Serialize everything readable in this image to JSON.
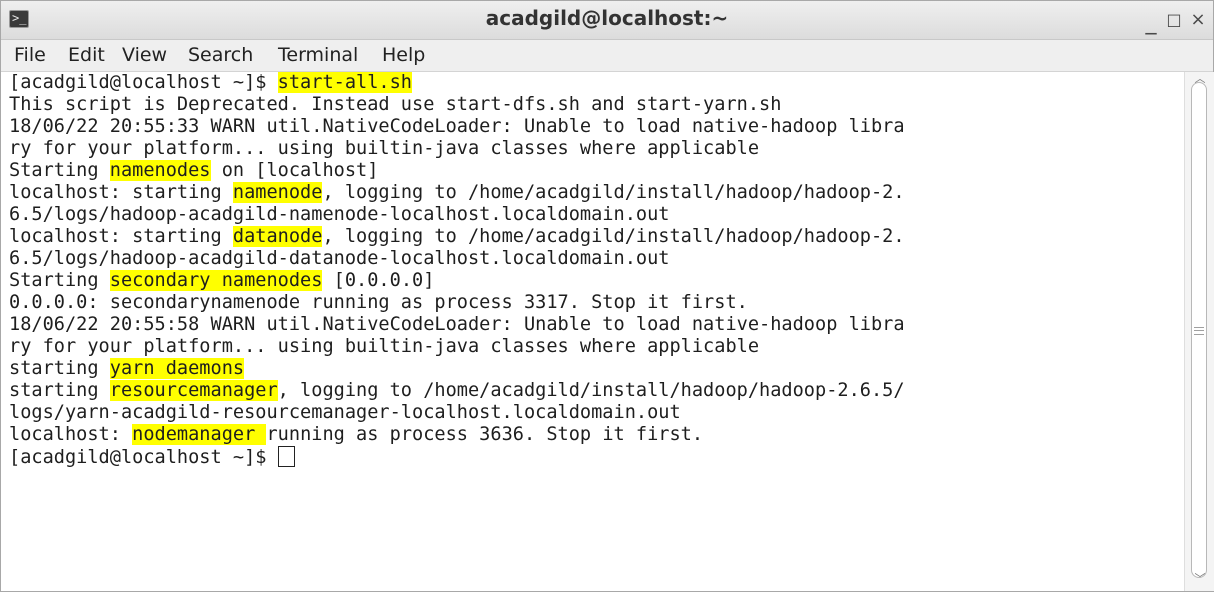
{
  "window": {
    "title": "acadgild@localhost:~",
    "icon": "terminal-icon",
    "controls": {
      "minimize": "_",
      "maximize": "□",
      "close": "×"
    }
  },
  "menu": [
    "File",
    "Edit",
    "View",
    "Search",
    "Terminal",
    "Help"
  ],
  "terminal": {
    "highlight_color": "#ffff00",
    "lines": [
      [
        {
          "t": "[acadgild@localhost ~]$ "
        },
        {
          "t": "start-all.sh",
          "hl": true
        }
      ],
      [
        {
          "t": "This script is Deprecated. Instead use start-dfs.sh and start-yarn.sh"
        }
      ],
      [
        {
          "t": "18/06/22 20:55:33 WARN util.NativeCodeLoader: Unable to load native-hadoop libra"
        }
      ],
      [
        {
          "t": "ry for your platform... using builtin-java classes where applicable"
        }
      ],
      [
        {
          "t": "Starting "
        },
        {
          "t": "namenodes",
          "hl": true
        },
        {
          "t": " on [localhost]"
        }
      ],
      [
        {
          "t": "localhost: starting "
        },
        {
          "t": "namenode",
          "hl": true
        },
        {
          "t": ", logging to /home/acadgild/install/hadoop/hadoop-2."
        }
      ],
      [
        {
          "t": "6.5/logs/hadoop-acadgild-namenode-localhost.localdomain.out"
        }
      ],
      [
        {
          "t": "localhost: starting "
        },
        {
          "t": "datanode",
          "hl": true
        },
        {
          "t": ", logging to /home/acadgild/install/hadoop/hadoop-2."
        }
      ],
      [
        {
          "t": "6.5/logs/hadoop-acadgild-datanode-localhost.localdomain.out"
        }
      ],
      [
        {
          "t": "Starting "
        },
        {
          "t": "secondary namenodes",
          "hl": true
        },
        {
          "t": " [0.0.0.0]"
        }
      ],
      [
        {
          "t": "0.0.0.0: secondarynamenode running as process 3317. Stop it first."
        }
      ],
      [
        {
          "t": "18/06/22 20:55:58 WARN util.NativeCodeLoader: Unable to load native-hadoop libra"
        }
      ],
      [
        {
          "t": "ry for your platform... using builtin-java classes where applicable"
        }
      ],
      [
        {
          "t": "starting "
        },
        {
          "t": "yarn daemons",
          "hl": true
        }
      ],
      [
        {
          "t": "starting "
        },
        {
          "t": "resourcemanager",
          "hl": true
        },
        {
          "t": ", logging to /home/acadgild/install/hadoop/hadoop-2.6.5/"
        }
      ],
      [
        {
          "t": "logs/yarn-acadgild-resourcemanager-localhost.localdomain.out"
        }
      ],
      [
        {
          "t": "localhost: "
        },
        {
          "t": "nodemanager ",
          "hl": true
        },
        {
          "t": "running as process 3636. Stop it first."
        }
      ],
      [
        {
          "t": "[acadgild@localhost ~]$ "
        },
        {
          "cursor": true
        }
      ]
    ]
  }
}
